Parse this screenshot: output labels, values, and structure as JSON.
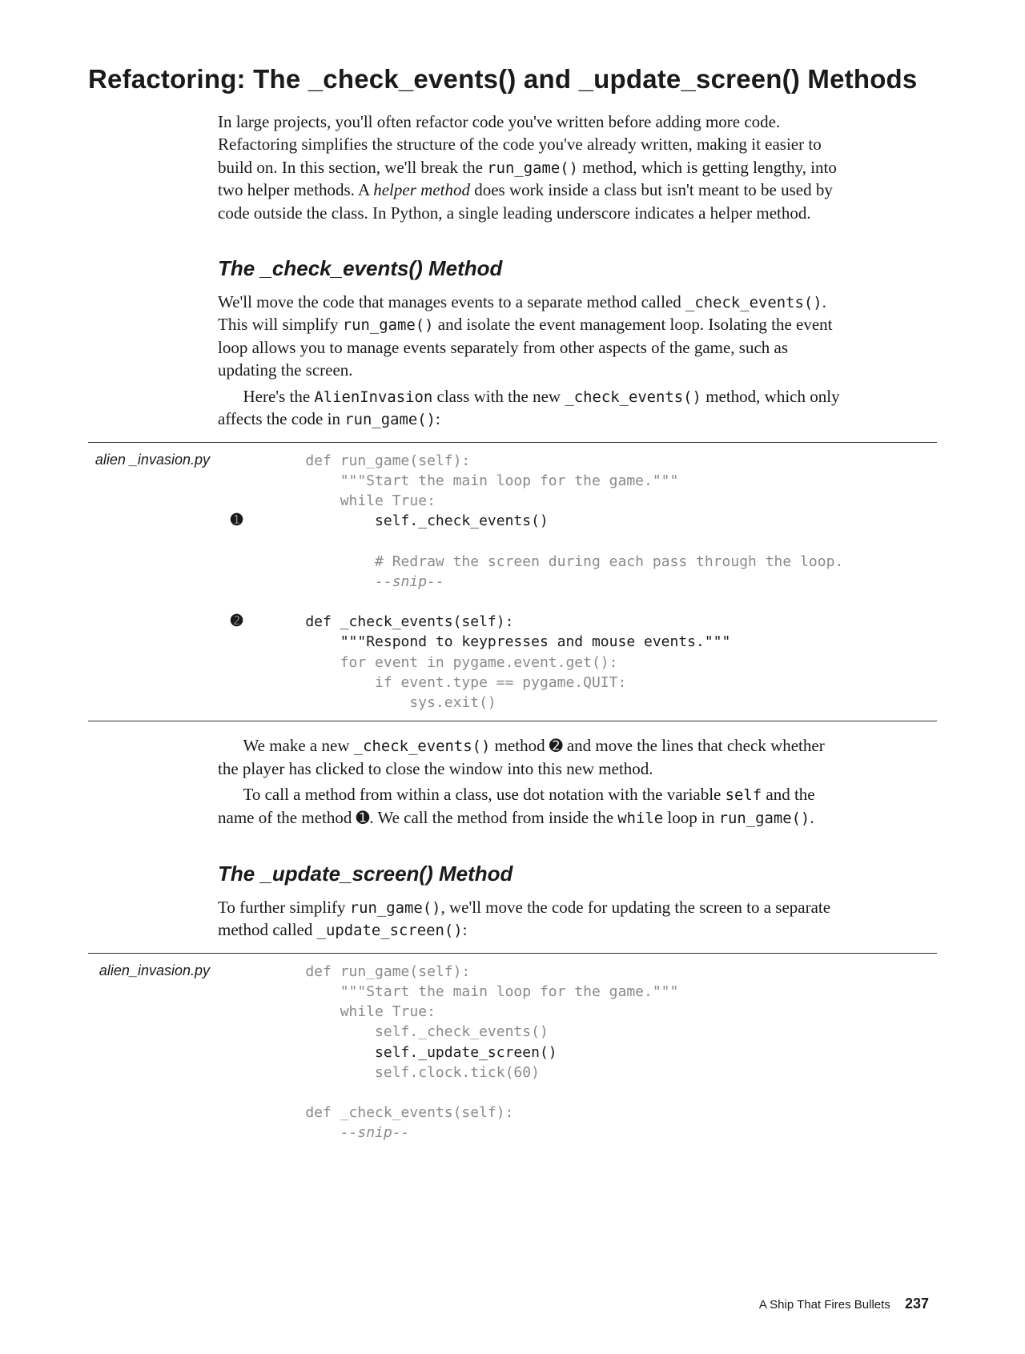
{
  "heading": "Refactoring: The _check_events() and _update_screen() Methods",
  "intro": {
    "p1a": "In large projects, you'll often refactor code you've written before adding more code. Refactoring simplifies the structure of the code you've already written, making it easier to build on. In this section, we'll break the ",
    "p1_code1": "run_game()",
    "p1b": " method, which is getting lengthy, into two helper methods. A ",
    "p1_ital": "helper method",
    "p1c": " does work inside a class but isn't meant to be used by code outside the class. In Python, a single leading underscore indicates a helper method."
  },
  "sec1": {
    "title": "The _check_events() Method",
    "p1a": "We'll move the code that manages events to a separate method called ",
    "p1_code1": "_check_events()",
    "p1b": ". This will simplify ",
    "p1_code2": "run_game()",
    "p1c": " and isolate the event management loop. Isolating the event loop allows you to manage events separately from other aspects of the game, such as updating the screen.",
    "p2a": "Here's the ",
    "p2_code1": "AlienInvasion",
    "p2b": " class with the new ",
    "p2_code2": "_check_events()",
    "p2c": " method, which only affects the code in ",
    "p2_code3": "run_game()",
    "p2d": ":"
  },
  "code1": {
    "filetag": "alien _invasion.py",
    "callout1": "➊",
    "callout2": "➋",
    "l1": "    def run_game(self):",
    "l2": "        \"\"\"Start the main loop for the game.\"\"\"",
    "l3": "        while True:",
    "l4": "            self._check_events()",
    "l5": "",
    "l6": "            # Redraw the screen during each pass through the loop.",
    "l7": "            --snip--",
    "l8": "",
    "l9": "    def _check_events(self):",
    "l10": "        \"\"\"Respond to keypresses and mouse events.\"\"\"",
    "l11": "        for event in pygame.event.get():",
    "l12": "            if event.type == pygame.QUIT:",
    "l13": "                sys.exit()"
  },
  "after1": {
    "p1a": "We make a new ",
    "p1_code1": "_check_events()",
    "p1b": " method ",
    "p1_ding1": "➋",
    "p1c": " and move the lines that check whether the player has clicked to close the window into this new method.",
    "p2a": "To call a method from within a class, use dot notation with the variable ",
    "p2_code1": "self",
    "p2b": " and the name of the method ",
    "p2_ding1": "➊",
    "p2c": ". We call the method from inside the ",
    "p2_code2": "while",
    "p2d": " loop in ",
    "p2_code3": "run_game()",
    "p2e": "."
  },
  "sec2": {
    "title": "The _update_screen() Method",
    "p1a": "To further simplify ",
    "p1_code1": "run_game()",
    "p1b": ", we'll move the code for updating the screen to a separate method called ",
    "p1_code2": "_update_screen()",
    "p1c": ":"
  },
  "code2": {
    "filetag": "alien_invasion.py",
    "l1": "    def run_game(self):",
    "l2": "        \"\"\"Start the main loop for the game.\"\"\"",
    "l3": "        while True:",
    "l4": "            self._check_events()",
    "l5": "            self._update_screen()",
    "l6": "            self.clock.tick(60)",
    "l7": "",
    "l8": "    def _check_events(self):",
    "l9": "        --snip--"
  },
  "footer": {
    "chapter": "A Ship That Fires Bullets",
    "page": "237"
  }
}
